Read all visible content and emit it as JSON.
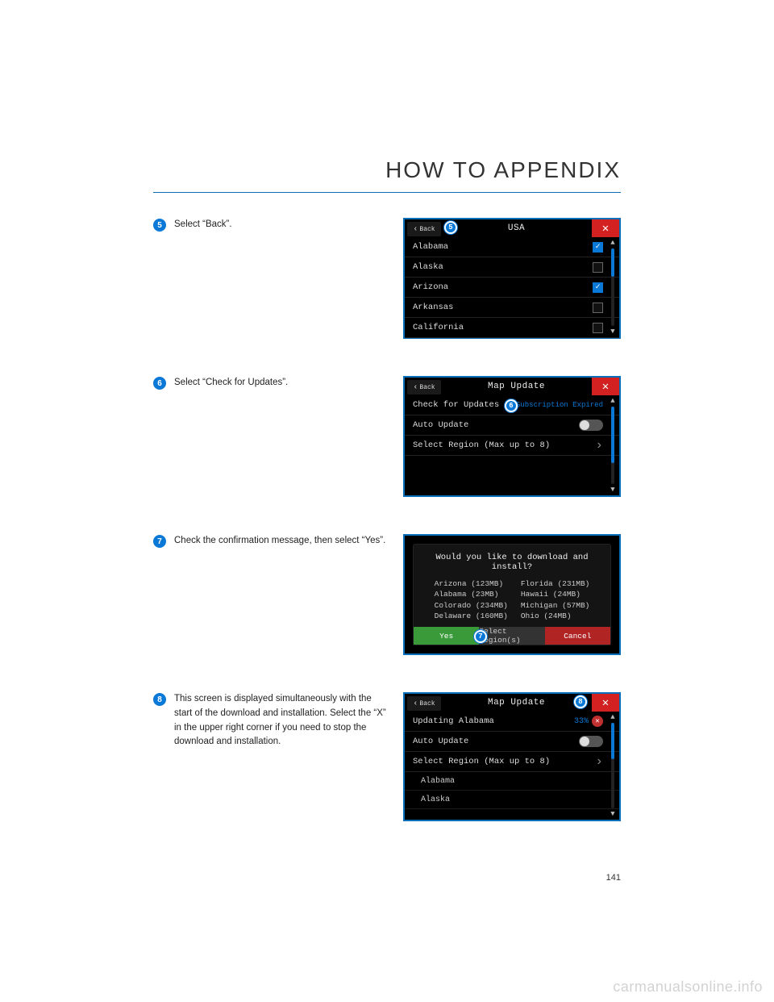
{
  "title": "HOW TO APPENDIX",
  "page_num": "141",
  "watermark": "carmanualsonline.info",
  "steps": [
    {
      "num": "5",
      "text": "Select “Back”.",
      "screen": {
        "back": "Back",
        "title": "USA",
        "marker": "5",
        "rows": [
          {
            "label": "Alabama",
            "checked": true
          },
          {
            "label": "Alaska",
            "checked": false
          },
          {
            "label": "Arizona",
            "checked": true
          },
          {
            "label": "Arkansas",
            "checked": false
          },
          {
            "label": "California",
            "checked": false
          }
        ]
      }
    },
    {
      "num": "6",
      "text": "Select “Check for Updates”.",
      "screen": {
        "back": "Back",
        "title": "Map Update",
        "marker": "6",
        "check_label": "Check for Updates",
        "sub_exp": "Subscription Expired",
        "auto_label": "Auto Update",
        "region_label": "Select Region (Max up to 8)"
      }
    },
    {
      "num": "7",
      "text": "Check the confirmation message, then select “Yes”.",
      "screen": {
        "question": "Would you like to download and install?",
        "col1": [
          "Arizona (123MB)",
          "Alabama (23MB)",
          "Colorado (234MB)",
          "Delaware (160MB)"
        ],
        "col2": [
          "Florida (231MB)",
          "Hawaii (24MB)",
          "Michigan (57MB)",
          "Ohio (24MB)"
        ],
        "yes": "Yes",
        "sel": "Select Region(s)",
        "cancel": "Cancel",
        "marker": "7"
      }
    },
    {
      "num": "8",
      "text": "This screen is displayed simultaneously with the start of the download and installation. Select the “X” in the upper right corner if you need to stop the download and installation.",
      "screen": {
        "back": "Back",
        "title": "Map Update",
        "marker": "8",
        "updating": "Updating Alabama",
        "pct": "33%",
        "auto_label": "Auto Update",
        "region_label": "Select Region (Max up to 8)",
        "subrows": [
          "Alabama",
          "Alaska"
        ]
      }
    }
  ]
}
